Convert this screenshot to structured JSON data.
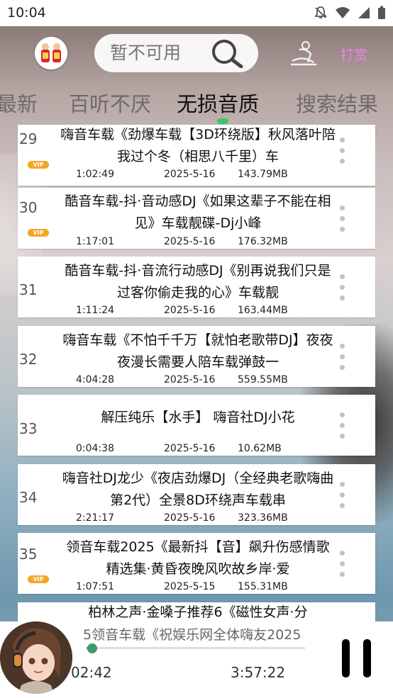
{
  "status_bar": {
    "time": "10:04"
  },
  "header": {
    "search_placeholder": "暂不可用",
    "punch_label": "打赏"
  },
  "tabs": [
    "最新",
    "百听不厌",
    "无损音质",
    "搜索结果"
  ],
  "active_tab": 2,
  "songs": [
    {
      "num": "29",
      "vip": true,
      "title": "嗨音车载《劲爆车载【3D环绕版】秋风落叶陪我过个冬（相思八千里）车",
      "duration": "1:02:49",
      "date": "2025-5-16",
      "size": "143.79MB"
    },
    {
      "num": "30",
      "vip": true,
      "title": "酷音车载-抖·音动感DJ《如果这辈子不能在相见》车载靓碟-Dj小峰",
      "duration": "1:17:01",
      "date": "2025-5-16",
      "size": "176.32MB"
    },
    {
      "num": "31",
      "vip": false,
      "title": "酷音车载-抖·音流行动感DJ《别再说我们只是过客你偷走我的心》车载靓",
      "duration": "1:11:24",
      "date": "2025-5-16",
      "size": "163.44MB"
    },
    {
      "num": "32",
      "vip": false,
      "title": "嗨音车载《不怕千千万【就怕老歌带DJ】夜夜夜漫长需要人陪车载弹鼓一",
      "duration": "4:04:28",
      "date": "2025-5-16",
      "size": "559.55MB"
    },
    {
      "num": "33",
      "vip": false,
      "title": "解压纯乐【水手】 嗨音社DJ小花",
      "duration": "0:04:38",
      "date": "2025-5-16",
      "size": "10.62MB"
    },
    {
      "num": "34",
      "vip": false,
      "title": "嗨音社DJ龙少《夜店劲爆DJ（全经典老歌嗨曲第2代）全景8D环绕声车载串",
      "duration": "2:21:17",
      "date": "2025-5-16",
      "size": "323.36MB"
    },
    {
      "num": "35",
      "vip": true,
      "title": "领音车载2025《最新抖【音】飙升伤感情歌精选集·黄昏夜晚风吹故乡岸·爱",
      "duration": "1:07:51",
      "date": "2025-5-15",
      "size": "155.31MB"
    },
    {
      "num": "",
      "vip": false,
      "title": "柏林之声·金嗓子推荐6《磁性女声·分",
      "duration": "",
      "date": "",
      "size": ""
    }
  ],
  "player": {
    "title": "5领音车载《祝娱乐网全体嗨友2025",
    "current_time": "02:42",
    "total_time": "3:57:22",
    "progress": 0.012
  },
  "colors": {
    "accent": "#3ec56b",
    "vip": "#f5a623",
    "punch": "#ee82ee"
  }
}
